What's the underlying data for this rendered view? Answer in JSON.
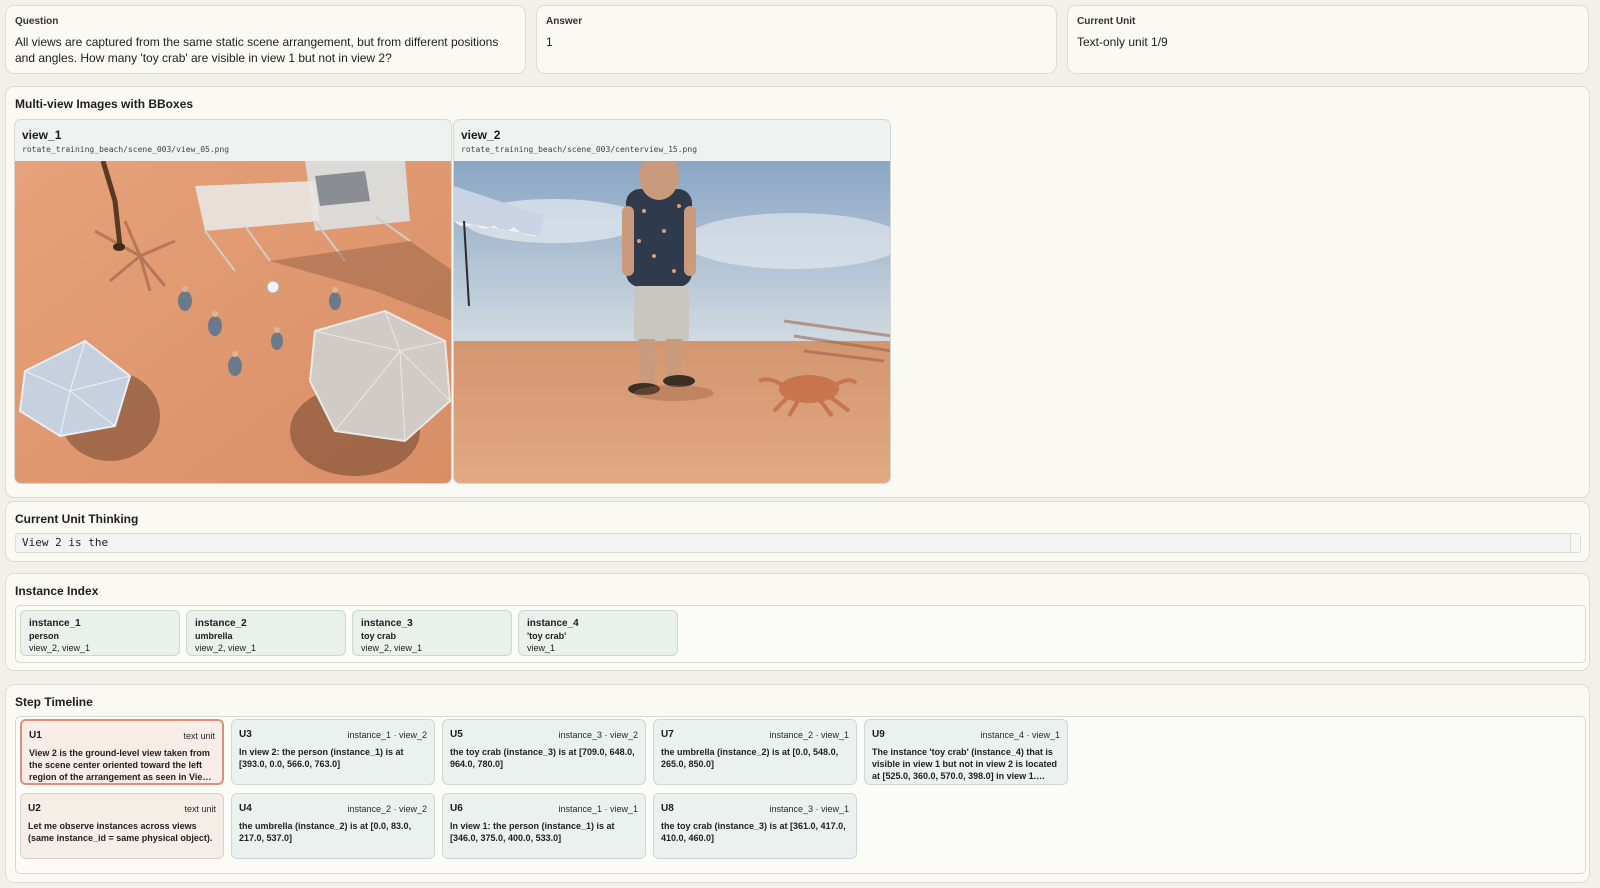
{
  "question": {
    "label": "Question",
    "text": "All views are captured from the same static scene arrangement, but from different positions and angles. How many 'toy crab' are visible in view 1 but not in view 2?"
  },
  "answer": {
    "label": "Answer",
    "text": "1"
  },
  "current_unit": {
    "label": "Current Unit",
    "text": "Text-only unit 1/9"
  },
  "multiview": {
    "title": "Multi-view Images with BBoxes",
    "views": [
      {
        "name": "view_1",
        "path": "rotate_training_beach/scene_003/view_05.png"
      },
      {
        "name": "view_2",
        "path": "rotate_training_beach/scene_003/centerview_15.png"
      }
    ]
  },
  "thinking": {
    "title": "Current Unit Thinking",
    "text": "View 2 is the"
  },
  "instance_index": {
    "title": "Instance Index",
    "items": [
      {
        "id": "instance_1",
        "label": "person",
        "views": "view_2, view_1"
      },
      {
        "id": "instance_2",
        "label": "umbrella",
        "views": "view_2, view_1"
      },
      {
        "id": "instance_3",
        "label": "toy crab",
        "views": "view_2, view_1"
      },
      {
        "id": "instance_4",
        "label": "'toy crab'",
        "views": "view_1"
      }
    ]
  },
  "timeline": {
    "title": "Step Timeline",
    "steps": [
      {
        "id": "U1",
        "meta": "text unit",
        "text": "View 2 is the ground-level view taken from the scene center oriented toward the left region of the arrangement as seen in Vie…"
      },
      {
        "id": "U2",
        "meta": "text unit",
        "text": "Let me observe instances across views (same instance_id = same physical object)."
      },
      {
        "id": "U3",
        "meta": "instance_1 · view_2",
        "text": "In view 2: the person (instance_1) is at [393.0, 0.0, 566.0, 763.0]"
      },
      {
        "id": "U4",
        "meta": "instance_2 · view_2",
        "text": "the umbrella (instance_2) is at [0.0, 83.0, 217.0, 537.0]"
      },
      {
        "id": "U5",
        "meta": "instance_3 · view_2",
        "text": "the toy crab (instance_3) is at [709.0, 648.0, 964.0, 780.0]"
      },
      {
        "id": "U6",
        "meta": "instance_1 · view_1",
        "text": "In view 1: the person (instance_1) is at [346.0, 375.0, 400.0, 533.0]"
      },
      {
        "id": "U7",
        "meta": "instance_2 · view_1",
        "text": "the umbrella (instance_2) is at [0.0, 548.0, 265.0, 850.0]"
      },
      {
        "id": "U8",
        "meta": "instance_3 · view_1",
        "text": "the toy crab (instance_3) is at [361.0, 417.0, 410.0, 460.0]"
      },
      {
        "id": "U9",
        "meta": "instance_4 · view_1",
        "text": "The instance 'toy crab' (instance_4) that is visible in view 1 but not in view 2 is located at [525.0, 360.0, 570.0, 398.0] in view 1.…"
      }
    ]
  }
}
